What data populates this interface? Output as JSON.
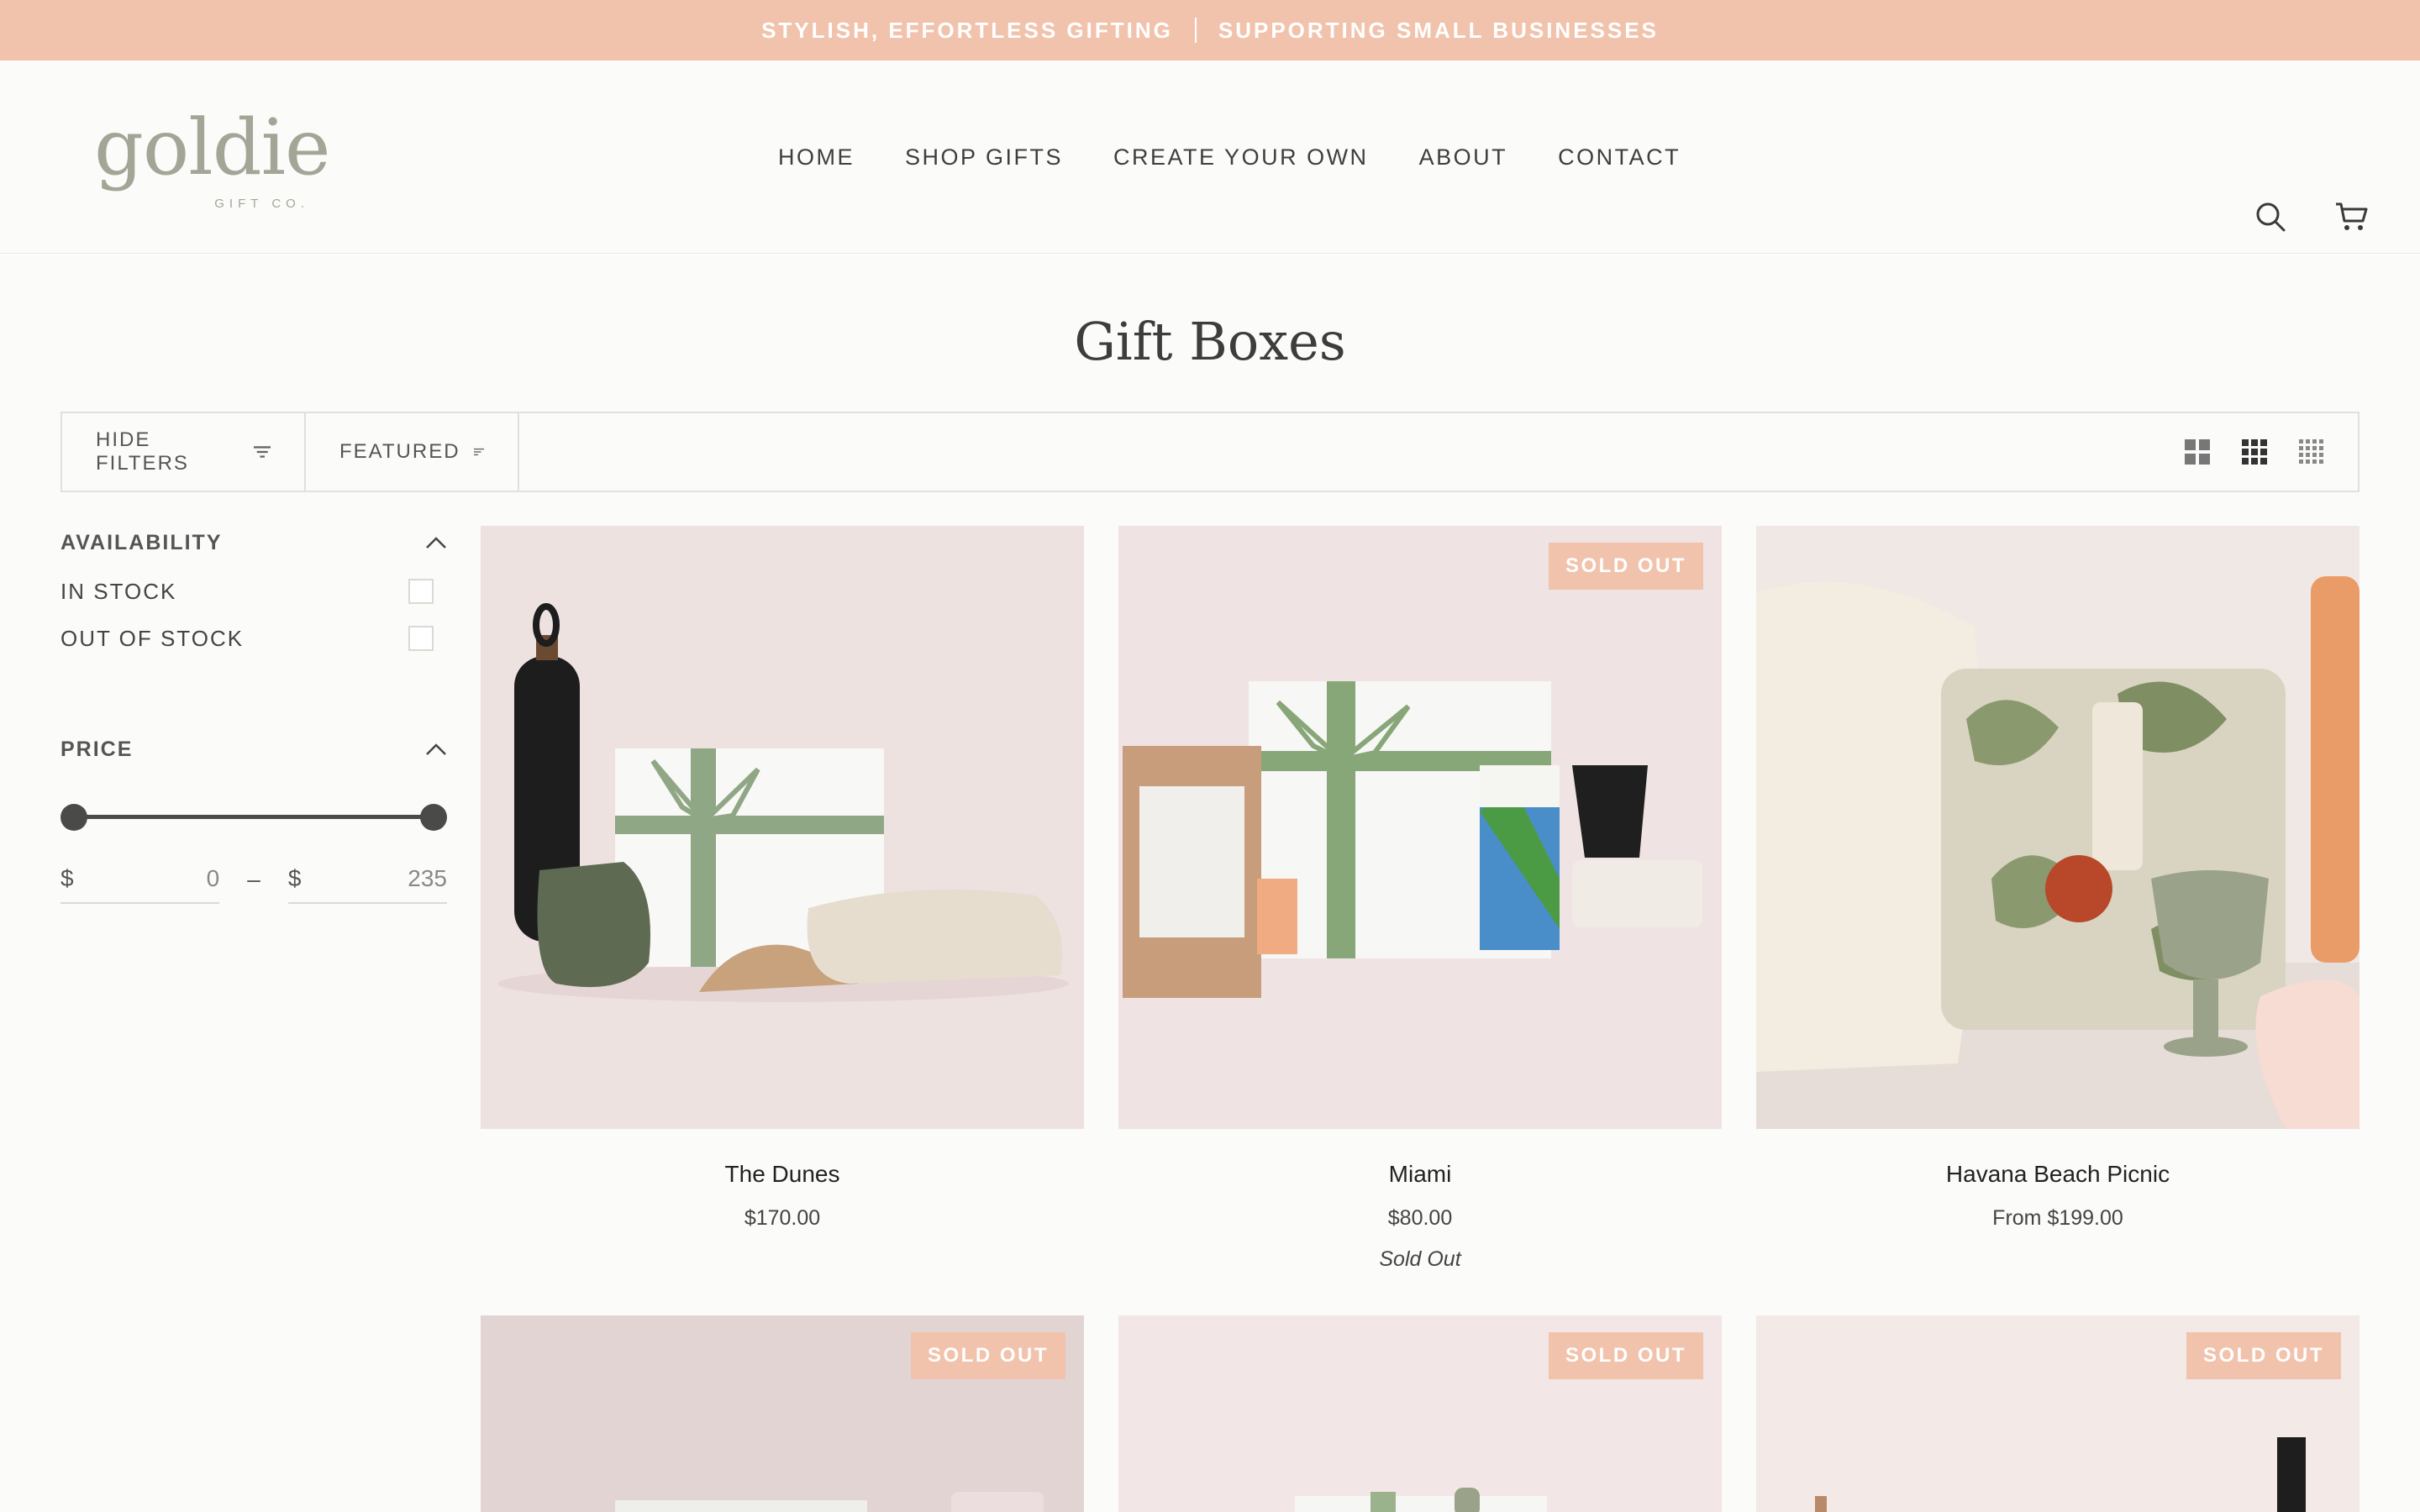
{
  "announcement": {
    "left": "STYLISH, EFFORTLESS GIFTING",
    "right": "SUPPORTING SMALL BUSINESSES"
  },
  "brand": {
    "name": "goldie",
    "sub": "GIFT CO."
  },
  "nav": [
    "HOME",
    "SHOP GIFTS",
    "CREATE YOUR OWN",
    "ABOUT",
    "CONTACT"
  ],
  "header_icons": [
    "search-icon",
    "cart-icon"
  ],
  "page_title": "Gift Boxes",
  "toolbar": {
    "hide_filters": "HIDE FILTERS",
    "sort": "FEATURED",
    "grid_options": [
      "grid-2-icon",
      "grid-3-icon",
      "grid-4-icon"
    ]
  },
  "filters": {
    "availability": {
      "heading": "AVAILABILITY",
      "options": [
        "IN STOCK",
        "OUT OF STOCK"
      ]
    },
    "price": {
      "heading": "PRICE",
      "currency": "$",
      "min": "0",
      "max": "235",
      "separator": "–"
    }
  },
  "products": [
    {
      "name": "The Dunes",
      "price": "$170.00",
      "status": "",
      "badge": ""
    },
    {
      "name": "Miami",
      "price": "$80.00",
      "status": "Sold Out",
      "badge": "SOLD OUT"
    },
    {
      "name": "Havana Beach Picnic",
      "price": "From $199.00",
      "status": "",
      "badge": ""
    },
    {
      "name": "",
      "price": "",
      "status": "",
      "badge": "SOLD OUT"
    },
    {
      "name": "",
      "price": "",
      "status": "",
      "badge": "SOLD OUT"
    },
    {
      "name": "",
      "price": "",
      "status": "",
      "badge": "SOLD OUT"
    }
  ],
  "colors": {
    "accent": "#f1c3ac",
    "card_bg": "#efe3e3",
    "text": "#3e3e3e"
  }
}
